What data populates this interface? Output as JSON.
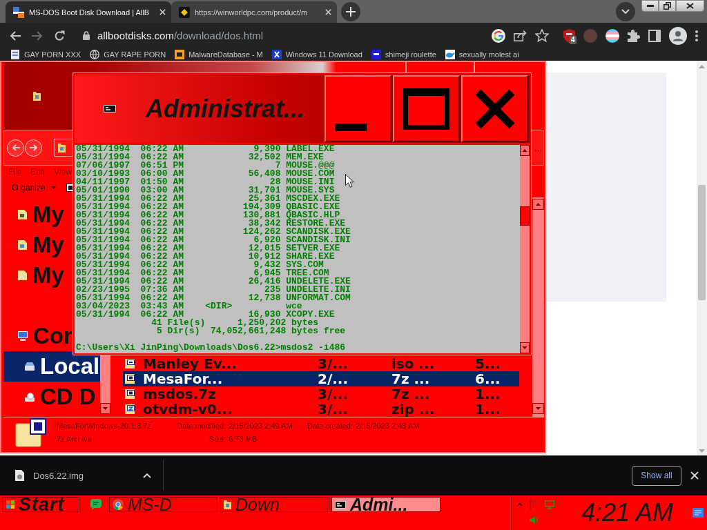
{
  "browser": {
    "tabs": [
      {
        "title": "MS-DOS Boot Disk Download | AllB",
        "kind": "tiles",
        "selected": true
      },
      {
        "title": "https://winworldpc.com/product/m",
        "kind": "monogram",
        "selected": false
      }
    ],
    "forward_disabled": true,
    "address": {
      "host": "allbootdisks.com",
      "path": "/download/dos.html"
    },
    "extension_badge": "4",
    "bookmarks": [
      {
        "label": "GAY PORN XXX",
        "kind": "page"
      },
      {
        "label": "GAY RAPE PORN",
        "kind": "globe"
      },
      {
        "label": "MalwareDatabase - M",
        "kind": "orange-tile"
      },
      {
        "label": "Windows 11 Download",
        "kind": "cross"
      },
      {
        "label": "shimeji roulette",
        "kind": "blue-tile"
      },
      {
        "label": "sexually molest ai",
        "kind": "bird"
      }
    ]
  },
  "explorer": {
    "overflow": "...",
    "menu": [
      "File",
      "Edit",
      "View"
    ],
    "organize": "Organize",
    "nav_groups": [
      {
        "items": [
          {
            "label": "My",
            "kind": "documents",
            "selected": false
          },
          {
            "label": "My",
            "kind": "music",
            "selected": false
          },
          {
            "label": "My",
            "kind": "pictures",
            "selected": false
          }
        ]
      },
      {
        "items": [
          {
            "label": "Cor",
            "kind": "computer",
            "selected": false,
            "children": [
              {
                "label": "Local",
                "kind": "drive",
                "selected": true
              },
              {
                "label": "CD D",
                "kind": "cd",
                "selected": false
              }
            ]
          }
        ]
      }
    ],
    "files": [
      {
        "name": "Manley Ev...",
        "date": "3/...",
        "type": "iso ...",
        "size": "5...",
        "kind": "disc",
        "selected": false
      },
      {
        "name": "MesaFor...",
        "date": "2/...",
        "type": "7z ...",
        "size": "6...",
        "kind": "archive",
        "selected": true
      },
      {
        "name": "msdos.7z",
        "date": "3/...",
        "type": "7z ...",
        "size": "1...",
        "kind": "archive",
        "selected": false
      },
      {
        "name": "otvdm-v0...",
        "date": "3/...",
        "type": "zip ...",
        "size": "1...",
        "kind": "zip",
        "selected": false
      }
    ],
    "details": {
      "name": "MesaForWindows-20.1.8.7z",
      "type": "7z Archive",
      "columns": [
        [
          {
            "label": "Date modified:",
            "value": "2/15/2023 2:49 AM"
          },
          {
            "label": "Size:",
            "value": "6.73 MB"
          }
        ],
        [
          {
            "label": "Date created:",
            "value": "2/15/2023 2:48 AM"
          }
        ]
      ]
    }
  },
  "console": {
    "title": "Administrat...",
    "lines": [
      "05/31/1994  06:22 AM             9,390 LABEL.EXE",
      "05/31/1994  06:22 AM            32,502 MEM.EXE",
      "07/06/1997  06:51 PM                 7 MOUSE.@@@",
      "03/10/1993  06:00 AM            56,408 MOUSE.COM",
      "04/11/1997  01:50 AM                28 MOUSE.INI",
      "05/01/1990  03:00 AM            31,701 MOUSE.SYS",
      "05/31/1994  06:22 AM            25,361 MSCDEX.EXE",
      "05/31/1994  06:22 AM           194,309 QBASIC.EXE",
      "05/31/1994  06:22 AM           130,881 QBASIC.HLP",
      "05/31/1994  06:22 AM            38,342 RESTORE.EXE",
      "05/31/1994  06:22 AM           124,262 SCANDISK.EXE",
      "05/31/1994  06:22 AM             6,920 SCANDISK.INI",
      "05/31/1994  06:22 AM            12,015 SETVER.EXE",
      "05/31/1994  06:22 AM            10,912 SHARE.EXE",
      "05/31/1994  06:22 AM             9,432 SYS.COM",
      "05/31/1994  06:22 AM             6,945 TREE.COM",
      "05/31/1994  06:22 AM            26,416 UNDELETE.EXE",
      "02/23/1995  07:36 AM               235 UNDELETE.INI",
      "05/31/1994  06:22 AM            12,738 UNFORMAT.COM",
      "03/04/2023  03:43 AM    <DIR>          wce",
      "05/31/1994  06:22 AM            16,930 XCOPY.EXE",
      "              41 File(s)      1,250,202 bytes",
      "               5 Dir(s)  74,052,661,248 bytes free"
    ],
    "prompt": "C:\\Users\\Xi JinPing\\Downloads\\Dos6.22>msdos2 -i486"
  },
  "downloads": {
    "items": [
      {
        "name": "Dos6.22.img"
      }
    ],
    "show_all": "Show all"
  },
  "taskbar": {
    "start": "Start",
    "tasks": [
      {
        "label": "MS-D",
        "kind": "browser",
        "selected": false
      },
      {
        "label": "Down",
        "kind": "folder",
        "selected": false
      },
      {
        "label": "Admi...",
        "kind": "console",
        "selected": true
      }
    ],
    "clock": "4:21 AM"
  }
}
